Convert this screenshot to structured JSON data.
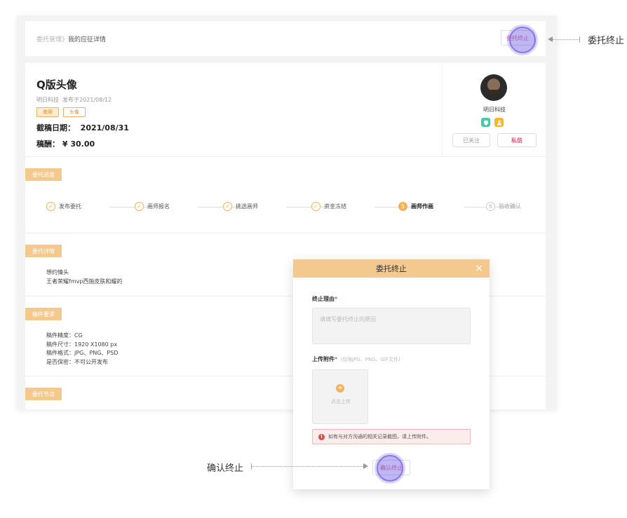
{
  "breadcrumb": {
    "parent": "委托管理》",
    "current": "我的应征详情"
  },
  "header": {
    "stop_button": "委托终止"
  },
  "order": {
    "title": "Q版头像",
    "company": "明日科技",
    "published": "发布于2021/08/12",
    "tags": [
      "商用",
      "头像"
    ],
    "deadline_label": "截稿日期：",
    "deadline_value": "2021/08/31",
    "fee_label": "稿酬：",
    "fee_value": "¥ 30.00"
  },
  "profile": {
    "name": "明日科技",
    "follow_button": "已关注",
    "message_button": "私信"
  },
  "sections": {
    "progress": "委托进度",
    "details": "委托详情",
    "requirements": "稿件要求",
    "milestones": "委托节点"
  },
  "steps": [
    {
      "label": "发布委托",
      "status": "done",
      "mark": "✓"
    },
    {
      "label": "画师报名",
      "status": "done",
      "mark": "✓"
    },
    {
      "label": "挑选画师",
      "status": "done",
      "mark": "✓"
    },
    {
      "label": "资金冻结",
      "status": "done",
      "mark": "✓"
    },
    {
      "label": "画师作画",
      "status": "active",
      "mark": "5"
    },
    {
      "label": "验收确认",
      "status": "pending",
      "mark": "6"
    }
  ],
  "details_text": [
    "想约情头",
    "王者荣耀fmvp西施皮肤和耀的"
  ],
  "requirements_text": [
    "稿件精度：CG",
    "稿件尺寸：1920 X1080 px",
    "稿件格式：JPG、PNG、PSD",
    "是否保密：不可公开发布"
  ],
  "modal": {
    "title": "委托终止",
    "close": "×",
    "reason_label": "终止理由",
    "required_mark": "*",
    "reason_placeholder": "请填写委托终止的原因",
    "attach_label": "上传附件",
    "attach_hint": "(仅限JPG、PNG、GIF文件)",
    "upload_plus": "+",
    "upload_text": "点击上传",
    "alert_icon": "!",
    "alert_text": "如有与对方沟通的相关记录截图，请上传附件。",
    "confirm_button": "确认终止"
  },
  "annotations": {
    "top_right": "委托终止",
    "bottom_left": "确认终止"
  },
  "colors": {
    "accent": "#f3c98e",
    "brand_orange": "#f0b25e",
    "danger_pink": "#e0567c",
    "click_purple": "#8a74e8"
  },
  "icons": {
    "close": "close-icon",
    "check": "check-icon",
    "plus": "plus-icon",
    "alert": "alert-icon",
    "verified": "shield-icon",
    "user": "user-icon"
  }
}
